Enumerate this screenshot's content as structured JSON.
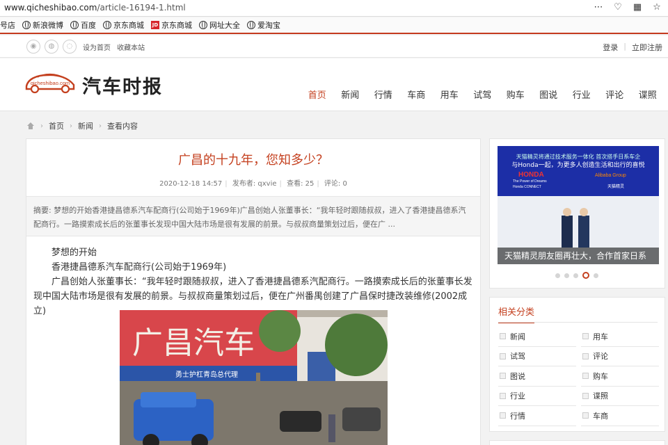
{
  "browser": {
    "url_host": "www.qicheshibao.com",
    "url_path": "/article-16194-1.html",
    "bookmarks": [
      {
        "label": "号店",
        "icon": "none"
      },
      {
        "label": "新浪微博",
        "icon": "globe-icon"
      },
      {
        "label": "百度",
        "icon": "globe-icon"
      },
      {
        "label": "京东商城",
        "icon": "globe-icon"
      },
      {
        "label": "京东商城",
        "icon": "jd-icon"
      },
      {
        "label": "网址大全",
        "icon": "globe-icon"
      },
      {
        "label": "爱淘宝",
        "icon": "globe-icon"
      }
    ],
    "jd_badge": "JD"
  },
  "topbar": {
    "set_home": "设为首页",
    "bookmark_site": "收藏本站",
    "login": "登录",
    "sep": "|",
    "register": "立即注册"
  },
  "header": {
    "logo_domain": "qicheshibao.com",
    "logo_text": "汽车时报",
    "nav": [
      "首页",
      "新闻",
      "行情",
      "车商",
      "用车",
      "试驾",
      "购车",
      "图说",
      "行业",
      "评论",
      "谍照"
    ],
    "nav_active_index": 0
  },
  "breadcrumb": [
    "首页",
    "新闻",
    "查看内容"
  ],
  "article": {
    "title": "广昌的十九年，您知多少？",
    "date": "2020-12-18 14:57",
    "author_label": "发布者: qxvie",
    "views_label": "查看: 25",
    "comments_label": "评论: 0",
    "summary": "摘要: 梦想的开始香港捷昌德系汽车配商行(公司始于1969年)广昌创始人张董事长：“我年轻时跟随叔叔，进入了香港捷昌德系汽配商行。一路摸索成长后的张董事长发现中国大陆市场是很有发展的前景。与叔叔商量策划过后，便在广 ...",
    "paragraphs": [
      "梦想的开始",
      "香港捷昌德系汽车配商行(公司始于1969年)",
      "广昌创始人张董事长：“我年轻时跟随叔叔，进入了香港捷昌德系汽配商行。一路摸索成长后的张董事长发现中国大陆市场是很有发展的前景。与叔叔商量策划过后，便在广州番禺创建了广昌保时捷改装维修(2002成立)"
    ],
    "photo_sign": "广昌汽车",
    "photo_banner": "勇士护杠青岛总代理"
  },
  "sidebar": {
    "ad_line1": "天猫精灵将通过技术服务一体化  首次搭手日系车企",
    "ad_line2": "与Honda一起，为更多人创造生活和出行的喜悦",
    "ad_brand_left": "HONDA",
    "ad_brand_left_sub": "The Power of Dreams",
    "ad_connect": "Honda CONNECT",
    "ad_brand_right": "Alibaba Group",
    "ad_tmall": "天猫精灵",
    "ad_caption": "天猫精灵朋友圈再壮大，合作首家日系",
    "slides": 5,
    "active_slide": 3,
    "category_title": "相关分类",
    "categories": [
      "新闻",
      "用车",
      "试驾",
      "评论",
      "图说",
      "购车",
      "行业",
      "谍照",
      "行情",
      "车商"
    ]
  },
  "colors": {
    "accent": "#c4401f",
    "ad_blue": "#1c2ea6"
  }
}
